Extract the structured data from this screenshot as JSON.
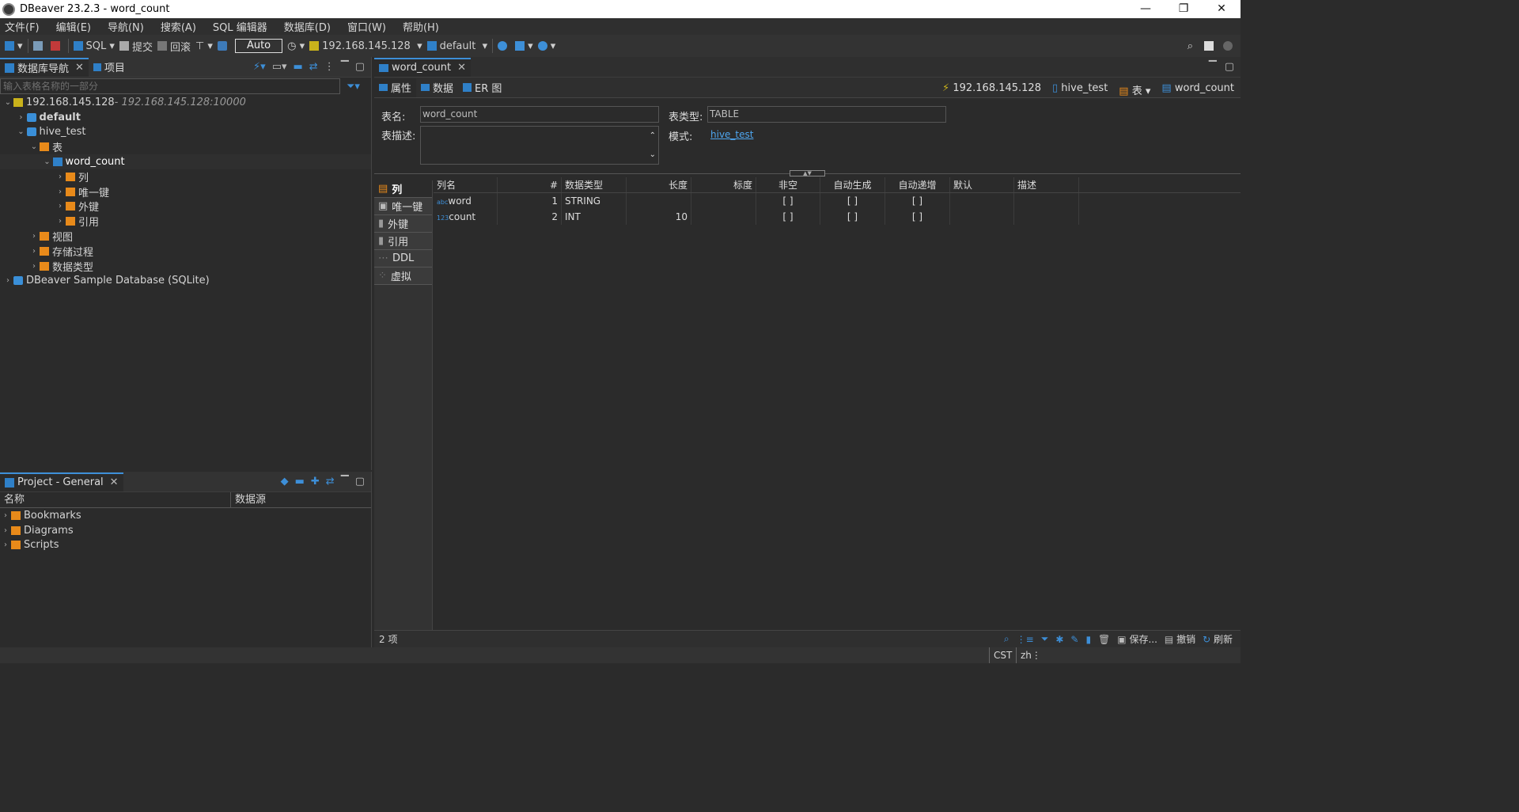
{
  "window": {
    "title": "DBeaver 23.2.3 - word_count",
    "min": "—",
    "max": "❐",
    "close": "✕"
  },
  "menu": [
    "文件(F)",
    "编辑(E)",
    "导航(N)",
    "搜索(A)",
    "SQL 编辑器",
    "数据库(D)",
    "窗口(W)",
    "帮助(H)"
  ],
  "toolbar": {
    "sql": "SQL",
    "commit": "提交",
    "rollback": "回滚",
    "auto": "Auto",
    "connection": "192.168.145.128",
    "schema": "default"
  },
  "navigator": {
    "tab_label": "数据库导航",
    "projects_tab_label": "项目",
    "search_placeholder": "输入表格名称的一部分",
    "tree": [
      {
        "label": "192.168.145.128",
        "suffix": " - 192.168.145.128:10000",
        "level": 0,
        "expanded": true,
        "icon": "connection-icon"
      },
      {
        "label": "default",
        "level": 1,
        "expanded": false,
        "bold": true,
        "icon": "database-icon"
      },
      {
        "label": "hive_test",
        "level": 1,
        "expanded": true,
        "icon": "database-icon"
      },
      {
        "label": "表",
        "level": 2,
        "expanded": true,
        "icon": "folder-icon"
      },
      {
        "label": "word_count",
        "level": 3,
        "expanded": true,
        "icon": "table-icon",
        "selected": true
      },
      {
        "label": "列",
        "level": 4,
        "expanded": false,
        "icon": "folder-icon"
      },
      {
        "label": "唯一键",
        "level": 4,
        "expanded": false,
        "icon": "folder-icon"
      },
      {
        "label": "外键",
        "level": 4,
        "expanded": false,
        "icon": "folder-icon"
      },
      {
        "label": "引用",
        "level": 4,
        "expanded": false,
        "icon": "folder-icon"
      },
      {
        "label": "视图",
        "level": 2,
        "expanded": false,
        "icon": "folder-icon"
      },
      {
        "label": "存储过程",
        "level": 2,
        "expanded": false,
        "icon": "folder-icon"
      },
      {
        "label": "数据类型",
        "level": 2,
        "expanded": false,
        "icon": "folder-icon"
      },
      {
        "label": "DBeaver Sample Database (SQLite)",
        "level": 0,
        "expanded": false,
        "icon": "sqlite-icon"
      }
    ]
  },
  "project": {
    "tab_label": "Project - General",
    "columns": [
      "名称",
      "数据源"
    ],
    "items": [
      "Bookmarks",
      "Diagrams",
      "Scripts"
    ]
  },
  "editor": {
    "tab_label": "word_count",
    "subtabs": [
      "属性",
      "数据",
      "ER 图"
    ],
    "breadcrumbs": [
      "192.168.145.128",
      "hive_test",
      "表",
      "word_count"
    ],
    "table_name_label": "表名:",
    "table_name": "word_count",
    "table_type_label": "表类型:",
    "table_type": "TABLE",
    "desc_label": "表描述:",
    "schema_label": "模式:",
    "schema_link": "hive_test",
    "side_tabs": [
      "列",
      "唯一键",
      "外键",
      "引用",
      "DDL",
      "虚拟"
    ],
    "columns_header": [
      "列名",
      "#",
      "数据类型",
      "长度",
      "标度",
      "非空",
      "自动生成",
      "自动递增",
      "默认",
      "描述"
    ],
    "rows": [
      {
        "type_icon": "abc",
        "name": "word",
        "num": "1",
        "datatype": "STRING",
        "length": "",
        "scale": "",
        "notnull": "[ ]",
        "autogen": "[ ]",
        "autoinc": "[ ]",
        "default": "",
        "desc": ""
      },
      {
        "type_icon": "123",
        "name": "count",
        "num": "2",
        "datatype": "INT",
        "length": "10",
        "scale": "",
        "notnull": "[ ]",
        "autogen": "[ ]",
        "autoinc": "[ ]",
        "default": "",
        "desc": ""
      }
    ],
    "status_count": "2 项",
    "save_label": "保存...",
    "undo_label": "撤销",
    "refresh_label": "刷新"
  },
  "statusbar": {
    "tz": "CST",
    "locale": "zh"
  }
}
